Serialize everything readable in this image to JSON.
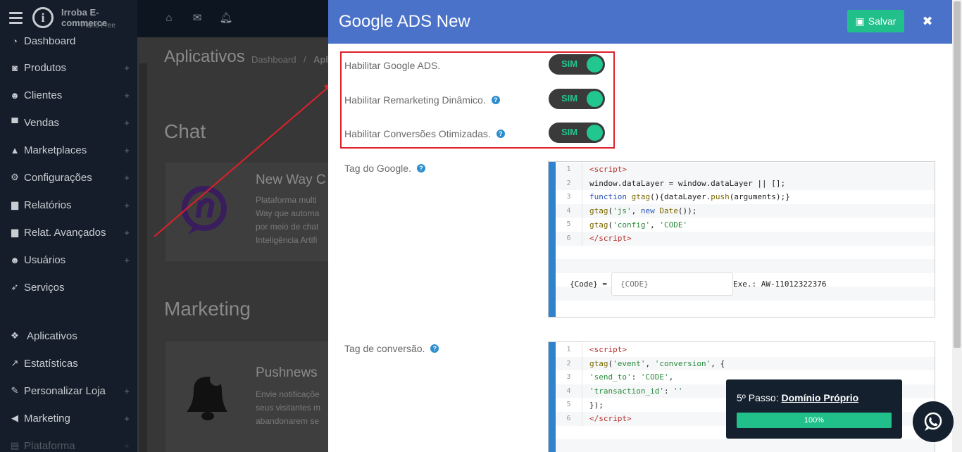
{
  "app": {
    "brand_name": "Irroba E-commerce",
    "plan": "Plano Free",
    "logo_letter": "i"
  },
  "sidebar": {
    "items": [
      {
        "label": "Dashboard",
        "icon": "dashboard-icon",
        "expandable": false
      },
      {
        "label": "Produtos",
        "icon": "camera-icon",
        "expandable": true
      },
      {
        "label": "Clientes",
        "icon": "users-icon",
        "expandable": true
      },
      {
        "label": "Vendas",
        "icon": "cart-icon",
        "expandable": true
      },
      {
        "label": "Marketplaces",
        "icon": "sitemap-icon",
        "expandable": true
      },
      {
        "label": "Configurações",
        "icon": "cogs-icon",
        "expandable": true
      },
      {
        "label": "Relatórios",
        "icon": "bar-chart-icon",
        "expandable": true
      },
      {
        "label": "Relat. Avançados",
        "icon": "bar-chart-icon",
        "expandable": true
      },
      {
        "label": "Usuários",
        "icon": "users-icon",
        "expandable": true
      },
      {
        "label": "Serviços",
        "icon": "rocket-icon",
        "expandable": false
      },
      {
        "label": "Aplicativos",
        "icon": "cubes-icon",
        "expandable": false
      },
      {
        "label": "Estatísticas",
        "icon": "line-chart-icon",
        "expandable": false
      },
      {
        "label": "Personalizar Loja",
        "icon": "brush-icon",
        "expandable": true
      },
      {
        "label": "Marketing",
        "icon": "bullhorn-icon",
        "expandable": true
      },
      {
        "label": "Plataforma",
        "icon": "server-icon",
        "expandable": true
      }
    ],
    "plus": "+"
  },
  "background": {
    "page_title": "Aplicativos",
    "breadcrumb": [
      "Dashboard",
      "Apl"
    ],
    "breadcrumb_sep": "/",
    "sections": [
      {
        "title": "Chat",
        "card_title": "New Way C",
        "card_text": "Plataforma multi\nWay que automa\npor meio de chat\nInteligência Artifi"
      },
      {
        "title": "Marketing",
        "card_title": "Pushnews",
        "card_text": "Envie notificaçõe\nseus visitantes m\nabandonarem se"
      }
    ]
  },
  "modal": {
    "title": "Google ADS New",
    "save_label": "Salvar",
    "close_label": "✖",
    "options": [
      {
        "label": "Habilitar Google ADS.",
        "toggle": "SIM",
        "help": false
      },
      {
        "label": "Habilitar Remarketing Dinâmico.",
        "toggle": "SIM",
        "help": true
      },
      {
        "label": "Habilitar Conversões Otimizadas.",
        "toggle": "SIM",
        "help": true
      }
    ],
    "help_glyph": "?",
    "google_tag": {
      "label": "Tag do Google.",
      "line_numbers": [
        "1",
        "2",
        "3",
        "4",
        "5",
        "6"
      ],
      "code_input_label": "{Code} =",
      "code_input_placeholder": "{CODE}",
      "code_example": "Exe.: AW-11012322376"
    },
    "conversion_tag": {
      "label": "Tag de conversão.",
      "line_numbers": [
        "1",
        "2",
        "3",
        "4",
        "5",
        "6"
      ]
    }
  },
  "onboarding": {
    "step_prefix": "5º Passo:",
    "step_link": "Domínio Próprio",
    "progress": 100,
    "progress_label": "100%"
  },
  "colors": {
    "header": "#4a72c9",
    "accent": "#21c08b",
    "highlight": "#e0202a"
  }
}
